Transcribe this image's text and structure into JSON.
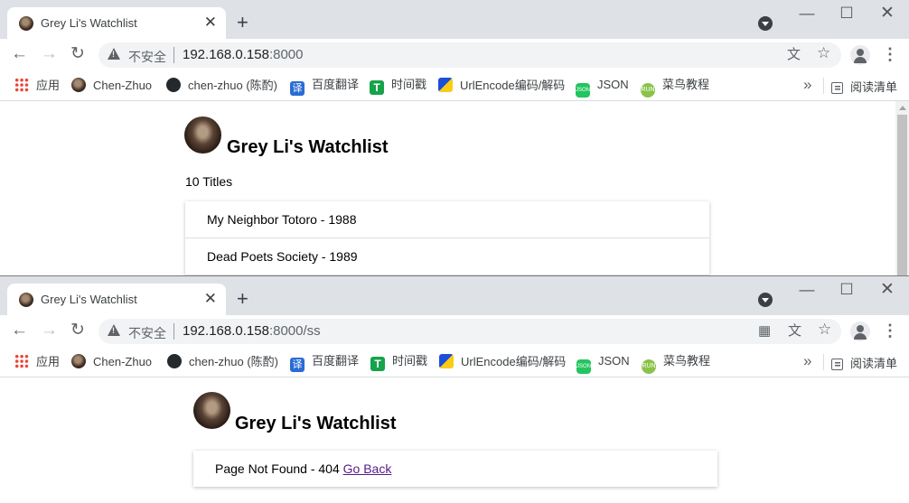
{
  "window1": {
    "tab_title": "Grey Li's Watchlist",
    "url_insecure": "不安全",
    "url_host": "192.168.0.158",
    "url_rest": ":8000",
    "page": {
      "heading": "Grey Li's Watchlist",
      "count": "10 Titles",
      "movies": [
        "My Neighbor Totoro - 1988",
        "Dead Poets Society - 1989"
      ]
    }
  },
  "window2": {
    "tab_title": "Grey Li's Watchlist",
    "url_insecure": "不安全",
    "url_host": "192.168.0.158",
    "url_rest": ":8000/ss",
    "page": {
      "heading": "Grey Li's Watchlist",
      "not_found_text": "Page Not Found - 404",
      "go_back": "Go Back"
    }
  },
  "bookmarks": [
    {
      "label": "应用",
      "icon": "apps-icon"
    },
    {
      "label": "Chen-Zhuo",
      "icon": "avatar-icon"
    },
    {
      "label": "chen-zhuo (陈酌)",
      "icon": "github-icon"
    },
    {
      "label": "百度翻译",
      "icon": "translate-icon"
    },
    {
      "label": "时间戳",
      "icon": "timestamp-icon"
    },
    {
      "label": "UrlEncode编码/解码",
      "icon": "urlencode-icon"
    },
    {
      "label": "JSON",
      "icon": "json-icon"
    },
    {
      "label": "菜鸟教程",
      "icon": "runoob-icon"
    }
  ],
  "reading_list": "阅读清单",
  "icons": {
    "back": "←",
    "forward": "→",
    "reload": "↻",
    "star": "☆",
    "translate": "文",
    "qr": "▦",
    "minimize": "—",
    "maximize": "☐",
    "close": "✕",
    "tab_close": "✕",
    "new_tab": "+",
    "more": "⋮",
    "chevron": "»"
  }
}
